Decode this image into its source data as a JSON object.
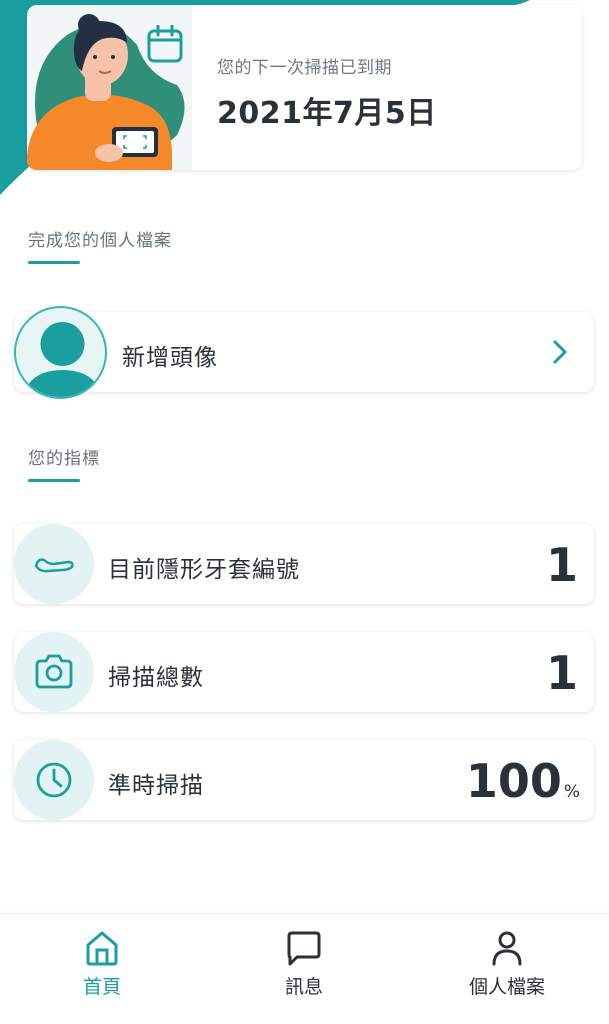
{
  "scan_card": {
    "caption": "您的下一次掃描已到期",
    "date": "2021年7月5日"
  },
  "profile_section": {
    "title": "完成您的個人檔案",
    "add_avatar_label": "新增頭像"
  },
  "metrics_section": {
    "title": "您的指標",
    "items": [
      {
        "label": "目前隱形牙套編號",
        "value": "1",
        "unit": "",
        "icon": "aligner-icon"
      },
      {
        "label": "掃描總數",
        "value": "1",
        "unit": "",
        "icon": "camera-icon"
      },
      {
        "label": "準時掃描",
        "value": "100",
        "unit": "%",
        "icon": "clock-icon"
      }
    ]
  },
  "bottom_nav": {
    "items": [
      {
        "label": "首頁",
        "icon": "home-icon",
        "active": true
      },
      {
        "label": "訊息",
        "icon": "message-icon",
        "active": false
      },
      {
        "label": "個人檔案",
        "icon": "person-icon",
        "active": false
      }
    ]
  },
  "colors": {
    "accent": "#1a9ea0",
    "text_dark": "#2a313a",
    "text_muted": "#6a737d",
    "icon_bg": "#e3f3f3",
    "orange": "#f5892a"
  }
}
